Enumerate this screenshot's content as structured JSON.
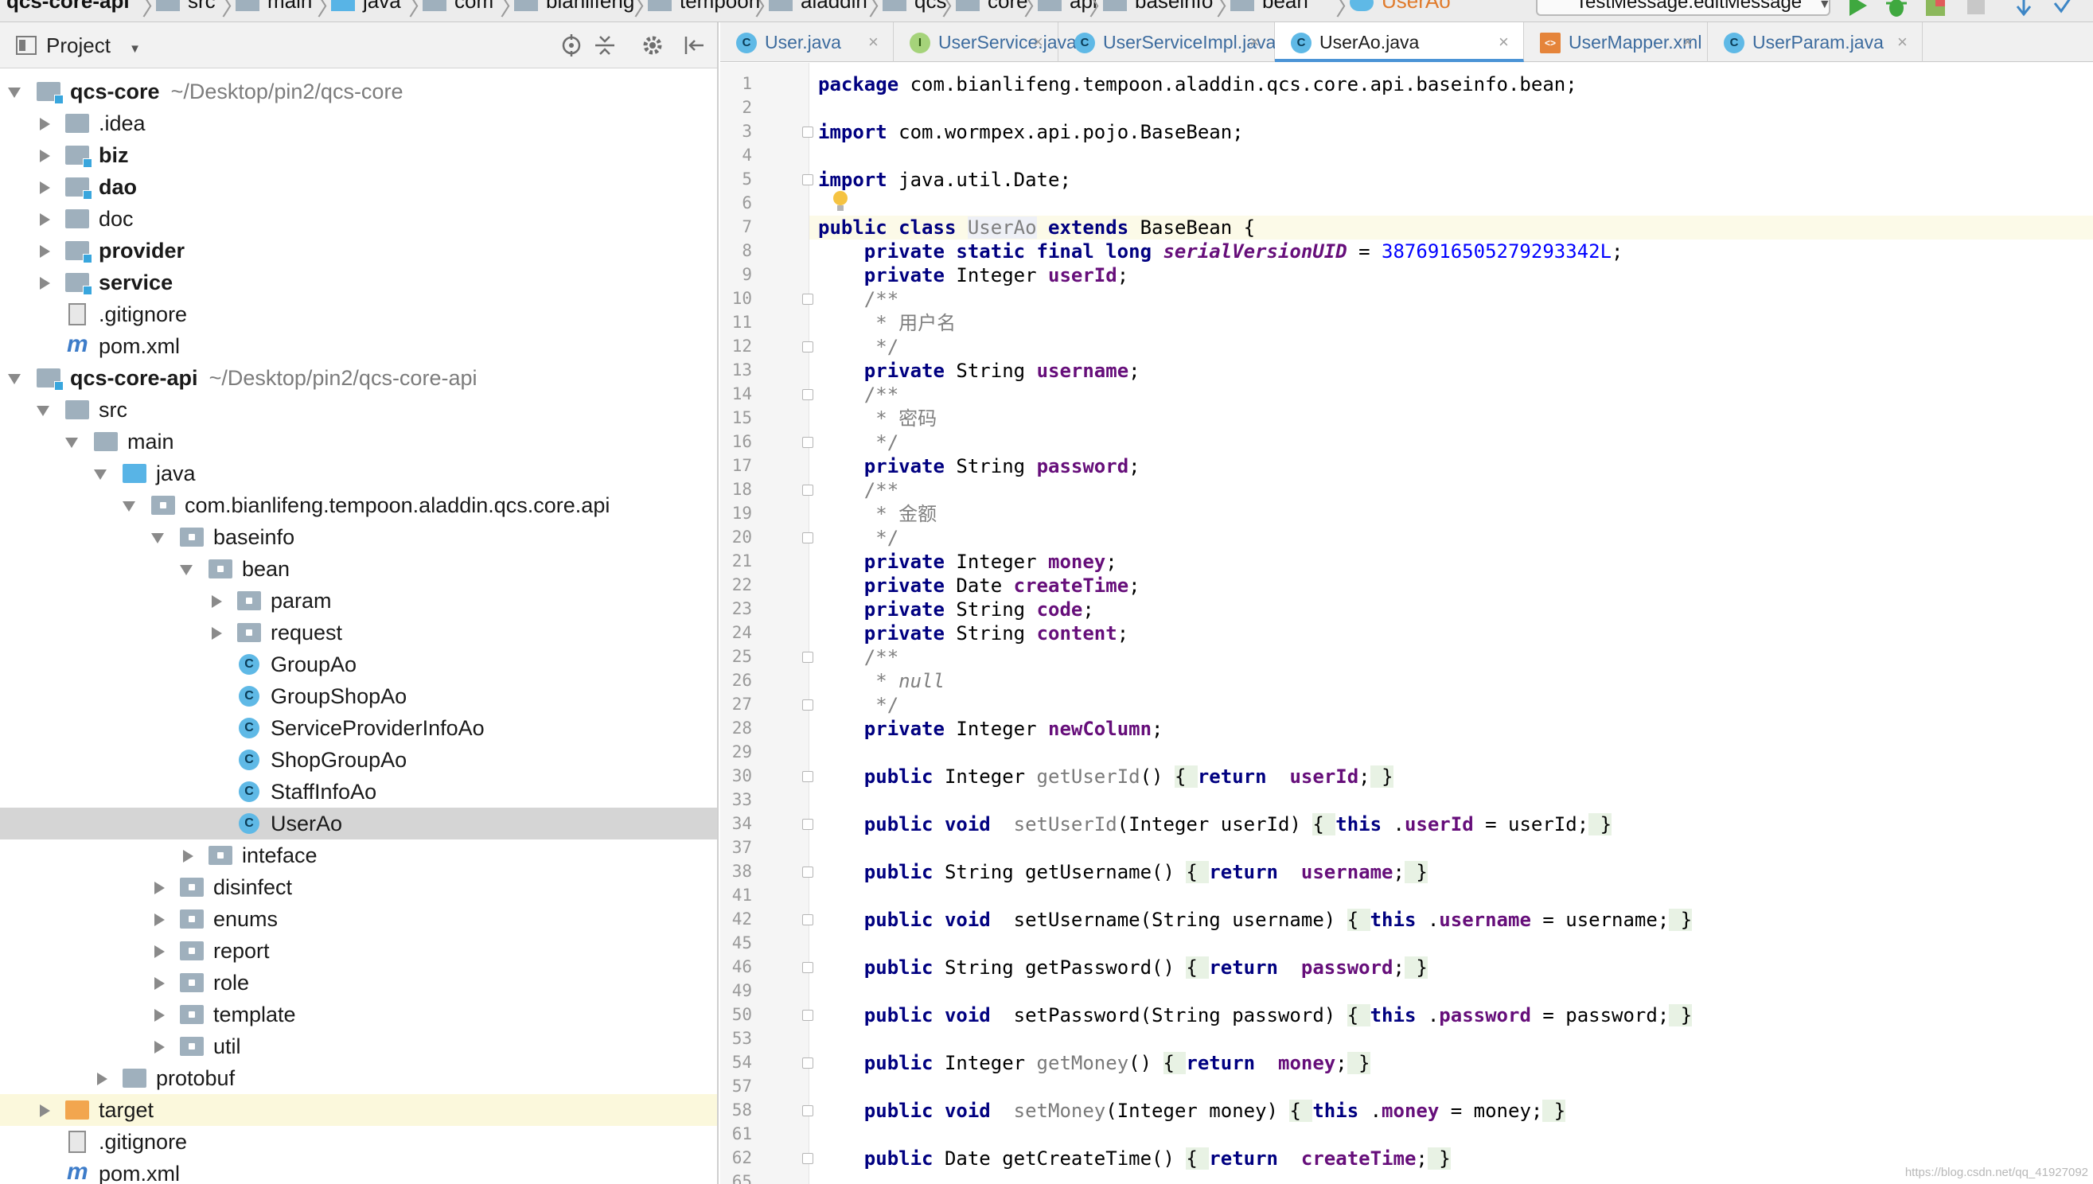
{
  "breadcrumbs": [
    "qcs-core-api",
    "src",
    "main",
    "java",
    "com",
    "bianlifeng",
    "tempoon",
    "aladdin",
    "qcs",
    "core",
    "api",
    "baseinfo",
    "bean",
    "UserAo"
  ],
  "toolbar": {
    "run_config": "TestMessage.editMessage"
  },
  "project_panel": {
    "title": "Project",
    "tree": [
      {
        "label": "qcs-core",
        "path": "~/Desktop/pin2/qcs-core",
        "bold": true,
        "icon": "module-folder-icon",
        "expanded": true
      },
      {
        "label": ".idea",
        "icon": "folder-icon"
      },
      {
        "label": "biz",
        "bold": true,
        "icon": "module-folder-icon"
      },
      {
        "label": "dao",
        "bold": true,
        "icon": "module-folder-icon"
      },
      {
        "label": "doc",
        "icon": "folder-icon"
      },
      {
        "label": "provider",
        "bold": true,
        "icon": "module-folder-icon"
      },
      {
        "label": "service",
        "bold": true,
        "icon": "module-folder-icon"
      },
      {
        "label": ".gitignore",
        "icon": "text-file-icon"
      },
      {
        "label": "pom.xml",
        "icon": "maven-icon"
      },
      {
        "label": "qcs-core-api",
        "path": "~/Desktop/pin2/qcs-core-api",
        "bold": true,
        "icon": "module-folder-icon",
        "expanded": true
      },
      {
        "label": "src",
        "icon": "folder-icon",
        "expanded": true
      },
      {
        "label": "main",
        "icon": "folder-icon",
        "expanded": true
      },
      {
        "label": "java",
        "icon": "source-folder-icon",
        "expanded": true
      },
      {
        "label": "com.bianlifeng.tempoon.aladdin.qcs.core.api",
        "icon": "package-icon",
        "expanded": true
      },
      {
        "label": "baseinfo",
        "icon": "package-icon",
        "expanded": true
      },
      {
        "label": "bean",
        "icon": "package-icon",
        "expanded": true
      },
      {
        "label": "param",
        "icon": "package-icon"
      },
      {
        "label": "request",
        "icon": "package-icon"
      },
      {
        "label": "GroupAo",
        "icon": "class-icon"
      },
      {
        "label": "GroupShopAo",
        "icon": "class-icon"
      },
      {
        "label": "ServiceProviderInfoAo",
        "icon": "class-icon"
      },
      {
        "label": "ShopGroupAo",
        "icon": "class-icon"
      },
      {
        "label": "StaffInfoAo",
        "icon": "class-icon"
      },
      {
        "label": "UserAo",
        "icon": "class-icon",
        "selected": true
      },
      {
        "label": "inteface",
        "icon": "package-icon"
      },
      {
        "label": "disinfect",
        "icon": "package-icon"
      },
      {
        "label": "enums",
        "icon": "package-icon"
      },
      {
        "label": "report",
        "icon": "package-icon"
      },
      {
        "label": "role",
        "icon": "package-icon"
      },
      {
        "label": "template",
        "icon": "package-icon"
      },
      {
        "label": "util",
        "icon": "package-icon"
      },
      {
        "label": "protobuf",
        "icon": "folder-icon"
      },
      {
        "label": "target",
        "icon": "excluded-folder-icon"
      },
      {
        "label": ".gitignore",
        "icon": "text-file-icon"
      },
      {
        "label": "pom.xml",
        "icon": "maven-icon"
      }
    ]
  },
  "tabs": [
    {
      "label": "User.java",
      "icon": "class-icon",
      "glyph": "C"
    },
    {
      "label": "UserService.java",
      "icon": "interface-icon",
      "glyph": "I"
    },
    {
      "label": "UserServiceImpl.java",
      "icon": "class-icon",
      "glyph": "C"
    },
    {
      "label": "UserAo.java",
      "icon": "class-icon",
      "glyph": "C",
      "active": true
    },
    {
      "label": "UserMapper.xml",
      "icon": "xml-file-icon",
      "glyph": "<>"
    },
    {
      "label": "UserParam.java",
      "icon": "class-icon",
      "glyph": "C"
    }
  ],
  "editor": {
    "line_numbers": [
      "1",
      "2",
      "3",
      "4",
      "5",
      "6",
      "7",
      "8",
      "9",
      "10",
      "11",
      "12",
      "13",
      "14",
      "15",
      "16",
      "17",
      "18",
      "19",
      "20",
      "21",
      "22",
      "23",
      "24",
      "25",
      "26",
      "27",
      "28",
      "29",
      "30",
      "33",
      "34",
      "37",
      "38",
      "41",
      "42",
      "45",
      "46",
      "49",
      "50",
      "53",
      "54",
      "57",
      "58",
      "61",
      "62",
      "65"
    ],
    "code_lines": [
      [
        [
          "kw",
          "package"
        ],
        [
          "",
          "com.bianlifeng.tempoon.aladdin.qcs.core.api.baseinfo.bean;"
        ]
      ],
      [],
      [
        [
          "kw",
          "import"
        ],
        [
          "",
          "com.wormpex.api.pojo.BaseBean;"
        ]
      ],
      [],
      [
        [
          "kw",
          "import"
        ],
        [
          "",
          "java.util.Date;"
        ]
      ],
      [],
      [
        [
          "kw",
          "public class"
        ],
        [
          "caret",
          ""
        ],
        [
          "sel-class",
          "UserAo"
        ],
        [
          "kw",
          " extends"
        ],
        [
          "",
          "BaseBean {"
        ]
      ],
      [
        [
          "",
          "    "
        ],
        [
          "kw",
          "private static final long"
        ],
        [
          "sfld",
          "serialVersionUID"
        ],
        [
          "",
          " = "
        ],
        [
          "num",
          "3876916505279293342L"
        ],
        [
          "",
          ";"
        ]
      ],
      [
        [
          "",
          "    "
        ],
        [
          "kw",
          "private"
        ],
        [
          "",
          "Integer "
        ],
        [
          "fld",
          "userId"
        ],
        [
          "",
          ";"
        ]
      ],
      [
        [
          "cmt",
          "    /**"
        ]
      ],
      [
        [
          "cmt",
          "     * 用户名"
        ]
      ],
      [
        [
          "cmt",
          "     */"
        ]
      ],
      [
        [
          "",
          "    "
        ],
        [
          "kw",
          "private"
        ],
        [
          "",
          "String "
        ],
        [
          "fld",
          "username"
        ],
        [
          "",
          ";"
        ]
      ],
      [
        [
          "cmt",
          "    /**"
        ]
      ],
      [
        [
          "cmt",
          "     * 密码"
        ]
      ],
      [
        [
          "cmt",
          "     */"
        ]
      ],
      [
        [
          "",
          "    "
        ],
        [
          "kw",
          "private"
        ],
        [
          "",
          "String "
        ],
        [
          "fld",
          "password"
        ],
        [
          "",
          ";"
        ]
      ],
      [
        [
          "cmt",
          "    /**"
        ]
      ],
      [
        [
          "cmt",
          "     * 金额"
        ]
      ],
      [
        [
          "cmt",
          "     */"
        ]
      ],
      [
        [
          "",
          "    "
        ],
        [
          "kw",
          "private"
        ],
        [
          "",
          "Integer "
        ],
        [
          "fld",
          "money"
        ],
        [
          "",
          ";"
        ]
      ],
      [
        [
          "",
          "    "
        ],
        [
          "kw",
          "private"
        ],
        [
          "",
          "Date "
        ],
        [
          "fld",
          "createTime"
        ],
        [
          "",
          ";"
        ]
      ],
      [
        [
          "",
          "    "
        ],
        [
          "kw",
          "private"
        ],
        [
          "",
          "String "
        ],
        [
          "fld",
          "code"
        ],
        [
          "",
          ";"
        ]
      ],
      [
        [
          "",
          "    "
        ],
        [
          "kw",
          "private"
        ],
        [
          "",
          "String "
        ],
        [
          "fld",
          "content"
        ],
        [
          "",
          ";"
        ]
      ],
      [
        [
          "cmt",
          "    /**"
        ]
      ],
      [
        [
          "cmt",
          "     * "
        ],
        [
          "cmt-i",
          "null"
        ]
      ],
      [
        [
          "cmt",
          "     */"
        ]
      ],
      [
        [
          "",
          "    "
        ],
        [
          "kw",
          "private"
        ],
        [
          "",
          "Integer "
        ],
        [
          "fld",
          "newColumn"
        ],
        [
          "",
          ";"
        ]
      ],
      [],
      [
        [
          "",
          "    "
        ],
        [
          "kw",
          "public"
        ],
        [
          "",
          "Integer "
        ],
        [
          "gray",
          "getUserId"
        ],
        [
          "",
          "() "
        ],
        [
          "brace",
          "{ "
        ],
        [
          "kw",
          "return"
        ],
        [
          "fld",
          " userId"
        ],
        [
          "",
          ";"
        ],
        [
          "brace",
          " }"
        ]
      ],
      [],
      [
        [
          "",
          "    "
        ],
        [
          "kw",
          "public void"
        ],
        [
          "gray",
          " setUserId"
        ],
        [
          "",
          "(Integer userId) "
        ],
        [
          "brace",
          "{ "
        ],
        [
          "kw",
          "this"
        ],
        [
          "",
          "."
        ],
        [
          "fld",
          "userId"
        ],
        [
          "",
          " = userId;"
        ],
        [
          "brace",
          " }"
        ]
      ],
      [],
      [
        [
          "",
          "    "
        ],
        [
          "kw",
          "public"
        ],
        [
          "",
          "String getUsername() "
        ],
        [
          "brace",
          "{ "
        ],
        [
          "kw",
          "return"
        ],
        [
          "fld",
          " username"
        ],
        [
          "",
          ";"
        ],
        [
          "brace",
          " }"
        ]
      ],
      [],
      [
        [
          "",
          "    "
        ],
        [
          "kw",
          "public void"
        ],
        [
          "",
          " setUsername(String username) "
        ],
        [
          "brace",
          "{ "
        ],
        [
          "kw",
          "this"
        ],
        [
          "",
          "."
        ],
        [
          "fld",
          "username"
        ],
        [
          "",
          " = username;"
        ],
        [
          "brace",
          " }"
        ]
      ],
      [],
      [
        [
          "",
          "    "
        ],
        [
          "kw",
          "public"
        ],
        [
          "",
          "String getPassword() "
        ],
        [
          "brace",
          "{ "
        ],
        [
          "kw",
          "return"
        ],
        [
          "fld",
          " password"
        ],
        [
          "",
          ";"
        ],
        [
          "brace",
          " }"
        ]
      ],
      [],
      [
        [
          "",
          "    "
        ],
        [
          "kw",
          "public void"
        ],
        [
          "",
          " setPassword(String password) "
        ],
        [
          "brace",
          "{ "
        ],
        [
          "kw",
          "this"
        ],
        [
          "",
          "."
        ],
        [
          "fld",
          "password"
        ],
        [
          "",
          " = password;"
        ],
        [
          "brace",
          " }"
        ]
      ],
      [],
      [
        [
          "",
          "    "
        ],
        [
          "kw",
          "public"
        ],
        [
          "",
          "Integer "
        ],
        [
          "gray",
          "getMoney"
        ],
        [
          "",
          "() "
        ],
        [
          "brace",
          "{ "
        ],
        [
          "kw",
          "return"
        ],
        [
          "fld",
          " money"
        ],
        [
          "",
          ";"
        ],
        [
          "brace",
          " }"
        ]
      ],
      [],
      [
        [
          "",
          "    "
        ],
        [
          "kw",
          "public void"
        ],
        [
          "gray",
          " setMoney"
        ],
        [
          "",
          "(Integer money) "
        ],
        [
          "brace",
          "{ "
        ],
        [
          "kw",
          "this"
        ],
        [
          "",
          "."
        ],
        [
          "fld",
          "money"
        ],
        [
          "",
          " = money;"
        ],
        [
          "brace",
          " }"
        ]
      ],
      [],
      [
        [
          "",
          "    "
        ],
        [
          "kw",
          "public"
        ],
        [
          "",
          "Date getCreateTime() "
        ],
        [
          "brace",
          "{ "
        ],
        [
          "kw",
          "return"
        ],
        [
          "fld",
          " createTime"
        ],
        [
          "",
          ";"
        ],
        [
          "brace",
          " }"
        ]
      ],
      []
    ],
    "fold_lines": [
      "3",
      "5",
      "10",
      "12",
      "14",
      "16",
      "18",
      "20",
      "25",
      "27",
      "30",
      "34",
      "38",
      "42",
      "46",
      "50",
      "54",
      "58",
      "62"
    ],
    "current_line": "7"
  },
  "watermark": "https://blog.csdn.net/qq_41927092",
  "colors": {
    "keyword": "#000080",
    "field": "#660e7a",
    "number": "#0000ff",
    "comment": "#808080",
    "selection": "#d5d5d5",
    "accent": "#4b94d6"
  }
}
